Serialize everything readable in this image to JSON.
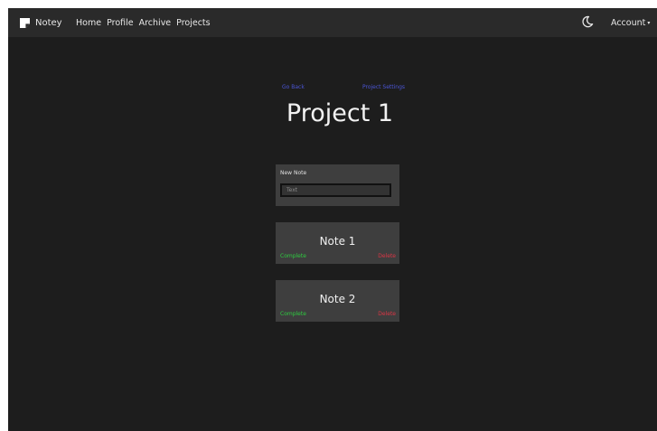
{
  "navbar": {
    "brand": "Notey",
    "links": [
      {
        "label": "Home"
      },
      {
        "label": "Profile"
      },
      {
        "label": "Archive"
      },
      {
        "label": "Projects"
      }
    ],
    "theme_toggle_icon": "moon-icon",
    "account_label": "Account",
    "account_caret": "▾"
  },
  "project": {
    "back_label": "Go Back",
    "settings_label": "Project Settings",
    "title": "Project 1"
  },
  "new_note": {
    "label": "New Note",
    "placeholder": "Text",
    "value": ""
  },
  "notes": [
    {
      "title": "Note 1",
      "complete_label": "Complete",
      "delete_label": "Delete"
    },
    {
      "title": "Note 2",
      "complete_label": "Complete",
      "delete_label": "Delete"
    }
  ],
  "colors": {
    "background": "#1d1d1d",
    "navbar": "#2a2a2a",
    "card": "#3e3e3e",
    "link": "#4b55d6",
    "complete": "#2ecc40",
    "delete": "#dc3545"
  }
}
